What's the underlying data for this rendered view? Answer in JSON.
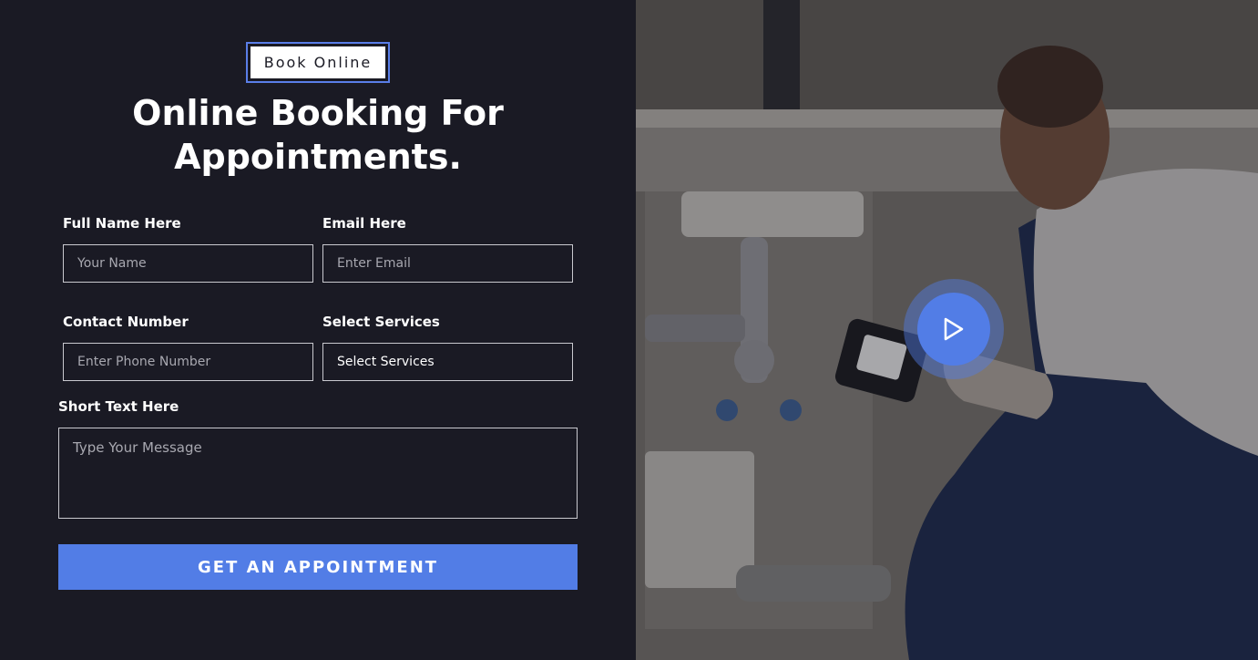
{
  "badge": {
    "label": "Book Online"
  },
  "heading": {
    "line1": "Online Booking For",
    "line2": "Appointments."
  },
  "form": {
    "full_name": {
      "label": "Full Name Here",
      "placeholder": "Your Name"
    },
    "email": {
      "label": "Email Here",
      "placeholder": "Enter Email"
    },
    "phone": {
      "label": "Contact Number",
      "placeholder": "Enter Phone Number"
    },
    "services": {
      "label": "Select Services",
      "selected": "Select Services"
    },
    "message": {
      "label": "Short Text Here",
      "placeholder": "Type Your Message"
    },
    "submit_label": "GET AN APPOINTMENT"
  },
  "media": {
    "play_icon": "play-icon",
    "accent": "#527de6"
  },
  "colors": {
    "background": "#1a1a24",
    "accent": "#527de6",
    "text": "#ffffff"
  }
}
